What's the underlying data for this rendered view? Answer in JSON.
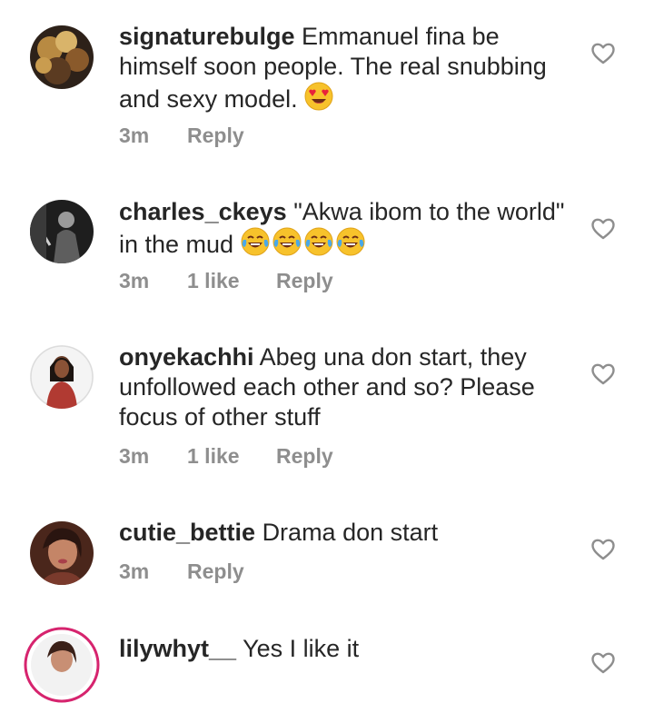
{
  "comments": [
    {
      "username": "signaturebulge",
      "text": "Emmanuel fina be himself soon people. The real snubbing and sexy model.",
      "emoji": "heart-eyes",
      "time": "3m",
      "likes": "",
      "reply": "Reply",
      "avatar_colors": [
        "#3a2a1e",
        "#c89a4a"
      ]
    },
    {
      "username": "charles_ckeys",
      "text": "\"Akwa ibom to the world\" in the mud",
      "emoji": "tears-of-joy x4",
      "time": "3m",
      "likes": "1 like",
      "reply": "Reply",
      "avatar_colors": [
        "#2b2b2b",
        "#bdbdbd"
      ]
    },
    {
      "username": "onyekachhi",
      "text": "Abeg una don start, they unfollowed each other and so?  Please focus of other stuff",
      "time": "3m",
      "likes": "1 like",
      "reply": "Reply",
      "avatar_colors": [
        "#f1f1f1",
        "#b13a32"
      ]
    },
    {
      "username": "cutie_bettie",
      "text": "Drama don start",
      "time": "3m",
      "likes": "",
      "reply": "Reply",
      "avatar_colors": [
        "#5a2f22",
        "#c8876a"
      ]
    },
    {
      "username": "lilywhyt__",
      "text": "Yes I like it",
      "time": "",
      "likes": "",
      "reply": "",
      "avatar_colors": [
        "#f2f2f2",
        "#d6246e"
      ]
    }
  ],
  "icons": {
    "like": "heart-outline-icon"
  },
  "colors": {
    "text": "#262626",
    "meta": "#8e8e8e",
    "story_ring": "#d6246e"
  }
}
